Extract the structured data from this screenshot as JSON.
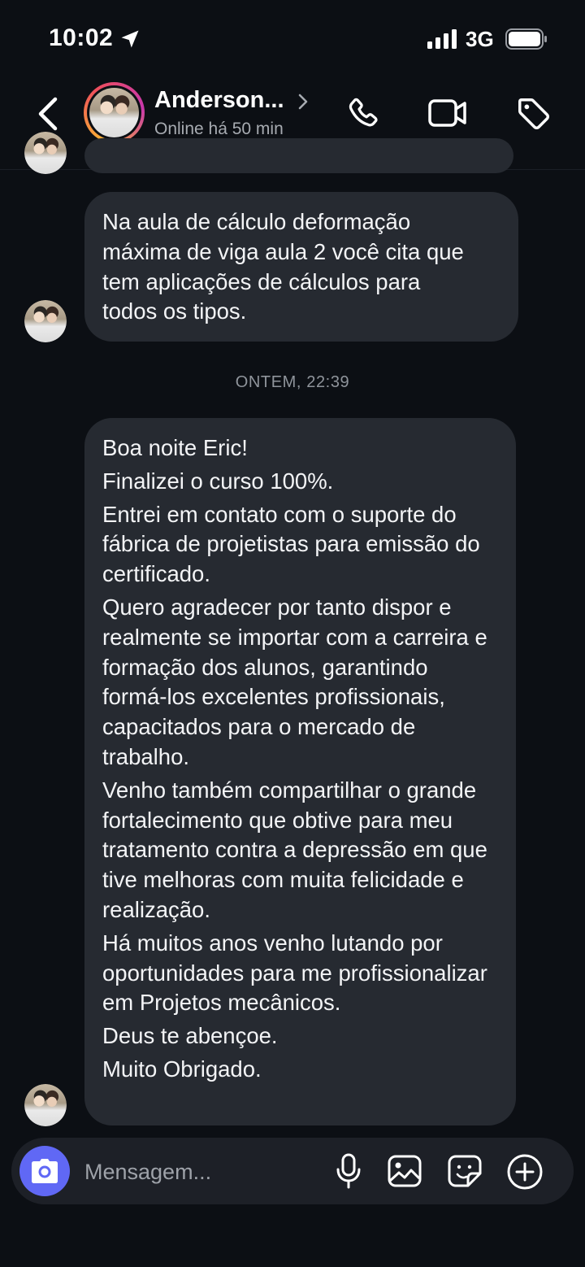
{
  "status_bar": {
    "time": "10:02",
    "network": "3G",
    "icons": [
      "location-arrow-icon",
      "signal-bars-icon",
      "battery-icon"
    ]
  },
  "header": {
    "contact_name": "Anderson...",
    "contact_status": "Online há 50 min",
    "icons": [
      "back-chevron-icon",
      "chevron-right-icon",
      "phone-icon",
      "video-camera-icon",
      "tag-icon"
    ],
    "story_ring_colors": [
      "#f9b233",
      "#ef4f5b",
      "#c837ab"
    ]
  },
  "conversation": {
    "message_1": {
      "lines": [
        "Na aula de cálculo deformação",
        "máxima de viga aula 2 você cita que",
        "tem aplicações de cálculos para",
        "todos os tipos."
      ]
    },
    "timestamp": "ONTEM, 22:39",
    "message_2": {
      "paragraphs": [
        "Boa noite Eric!",
        "Finalizei o curso 100%.",
        "Entrei em contato com o suporte do fábrica de projetistas para emissão do certificado.",
        "Quero agradecer por tanto dispor e realmente se importar com a carreira e formação dos alunos, garantindo formá-los excelentes profissionais, capacitados para o mercado de trabalho.",
        "Venho também compartilhar o grande fortalecimento que obtive para meu tratamento contra a depressão em que tive melhoras com muita felicidade e realização.",
        "Há muitos anos venho lutando por oportunidades para me profissionalizar em Projetos mecânicos.",
        "Deus te abençoe.",
        "Muito Obrigado."
      ]
    }
  },
  "composer": {
    "placeholder": "Mensagem...",
    "icons": [
      "camera-icon",
      "microphone-icon",
      "gallery-icon",
      "sticker-icon",
      "add-icon"
    ],
    "camera_button_color": "#6068f5"
  },
  "colors": {
    "background": "#0c0f14",
    "bubble": "#262a31",
    "timestamp_text": "#8f949b"
  }
}
